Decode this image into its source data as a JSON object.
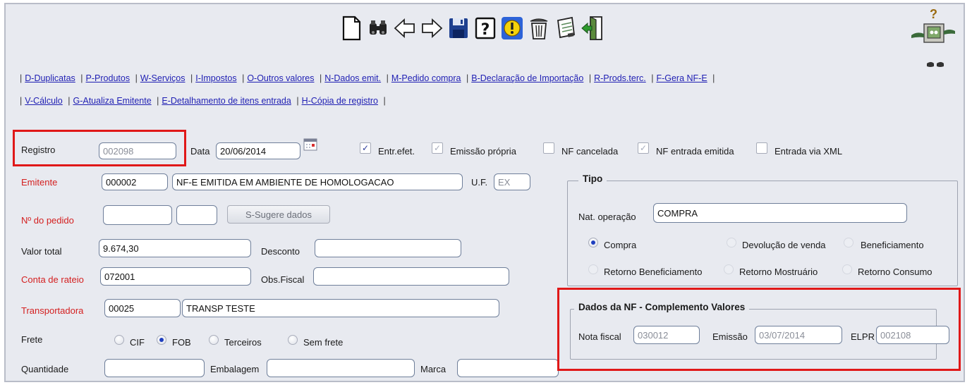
{
  "toolbar": {
    "items": [
      {
        "name": "new-document-icon"
      },
      {
        "name": "binoculars-search-icon"
      },
      {
        "name": "arrow-left-icon"
      },
      {
        "name": "arrow-right-icon"
      },
      {
        "name": "save-disk-icon"
      },
      {
        "name": "help-question-icon"
      },
      {
        "name": "warning-exclamation-icon"
      },
      {
        "name": "trash-bin-icon"
      },
      {
        "name": "notepad-edit-icon"
      },
      {
        "name": "exit-door-icon"
      }
    ],
    "help_mark": "?"
  },
  "menu": {
    "line1": [
      "D-Duplicatas",
      "P-Produtos",
      "W-Serviços",
      "I-Impostos",
      "O-Outros valores",
      "N-Dados emit.",
      "M-Pedido compra",
      "B-Declaração de Importação",
      "R-Prods.terc.",
      "F-Gera NF-E"
    ],
    "line2": [
      "V-Cálculo",
      "G-Atualiza Emitente",
      "E-Detalhamento de itens entrada",
      "H-Cópia de registro"
    ]
  },
  "form": {
    "registro_label": "Registro",
    "registro_value": "002098",
    "data_label": "Data",
    "data_value": "20/06/2014",
    "entr_efet_label": "Entr.efet.",
    "emissao_propria_label": "Emissão própria",
    "nf_cancelada_label": "NF cancelada",
    "nf_entrada_emitida_label": "NF entrada emitida",
    "entrada_xml_label": "Entrada via XML",
    "emitente_label": "Emitente",
    "emitente_code": "000002",
    "emitente_name": "NF-E EMITIDA EM AMBIENTE DE HOMOLOGACAO",
    "uf_label": "U.F.",
    "uf_value": "EX",
    "pedido_label": "Nº do pedido",
    "pedido_value1": "",
    "pedido_value2": "",
    "sugere_button": "S-Sugere dados",
    "valor_total_label": "Valor total",
    "valor_total_value": "9.674,30",
    "desconto_label": "Desconto",
    "desconto_value": "",
    "conta_rateio_label": "Conta de rateio",
    "conta_rateio_value": "072001",
    "obs_fiscal_label": "Obs.Fiscal",
    "obs_fiscal_value": "",
    "transportadora_label": "Transportadora",
    "transportadora_code": "00025",
    "transportadora_name": "TRANSP TESTE",
    "frete_label": "Frete",
    "frete_options": [
      "CIF",
      "FOB",
      "Terceiros",
      "Sem frete"
    ],
    "quantidade_label": "Quantidade",
    "quantidade_value": "",
    "embalagem_label": "Embalagem",
    "embalagem_value": "",
    "marca_label": "Marca",
    "marca_value": ""
  },
  "tipo": {
    "title": "Tipo",
    "nat_operacao_label": "Nat. operação",
    "nat_operacao_value": "COMPRA",
    "options": [
      "Compra",
      "Devolução de venda",
      "Beneficiamento",
      "Retorno Beneficiamento",
      "Retorno Mostruário",
      "Retorno Consumo"
    ]
  },
  "dados_nf": {
    "title": "Dados da NF - Complemento Valores",
    "nota_fiscal_label": "Nota fiscal",
    "nota_fiscal_value": "030012",
    "emissao_label": "Emissão",
    "emissao_value": "03/07/2014",
    "elpr_label": "ELPR",
    "elpr_value": "002108"
  },
  "colors": {
    "window_bg": "#e8eaf0",
    "link": "#1f1fb3",
    "required_label": "#d42020",
    "highlight": "#e01818"
  }
}
